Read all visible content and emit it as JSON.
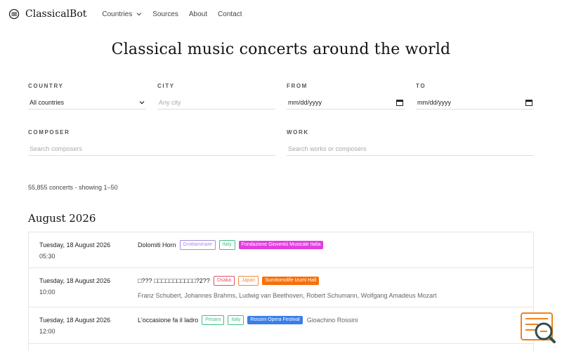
{
  "nav": {
    "brand": "ClassicalBot",
    "links": [
      "Countries",
      "Sources",
      "About",
      "Contact"
    ]
  },
  "hero": {
    "title": "Classical music concerts around the world"
  },
  "filters": {
    "country": {
      "label": "COUNTRY",
      "value": "All countries"
    },
    "city": {
      "label": "CITY",
      "placeholder": "Any city"
    },
    "from": {
      "label": "FROM",
      "value": "mm/dd/yyyy"
    },
    "to": {
      "label": "TO",
      "value": "mm/dd/yyyy"
    },
    "composer": {
      "label": "COMPOSER",
      "placeholder": "Search composers"
    },
    "work": {
      "label": "WORK",
      "placeholder": "Search works or composers"
    }
  },
  "results": {
    "count": "55,855 concerts - showing 1–50"
  },
  "month": "August 2026",
  "rows": [
    {
      "date": "Tuesday, 18 August 2026",
      "time": "05:30",
      "title": "Dolomiti Horn",
      "city": "Grottammare",
      "country": "Italy",
      "venue": "Fondazione Gioventù Musicale Italia",
      "venue_color": "#e13ee0",
      "city_color": "#a58be6",
      "country_color": "#3cbf86",
      "composers": ""
    },
    {
      "date": "Tuesday, 18 August 2026",
      "time": "10:00",
      "title": "□??? □□□□□□□□□□□?2??",
      "city": "Osaka",
      "country": "Japan",
      "venue": "Sumitomolife Izumi Hall",
      "venue_color": "#f7700c",
      "city_color": "#e2526a",
      "country_color": "#f08a3a",
      "composers": "Franz Schubert, Johannes Brahms, Ludwig van Beethoven, Robert Schumann, Wolfgang Amadeus Mozart"
    },
    {
      "date": "Tuesday, 18 August 2026",
      "time": "12:00",
      "title": "L'occasione fa il ladro",
      "city": "Pesaro",
      "country": "Italy",
      "venue": "Rossini Opera Festival",
      "venue_color": "#3a7ee8",
      "city_color": "#3cbf86",
      "country_color": "#3cbf86",
      "composers": "Gioachino Rossini"
    }
  ],
  "colors": {
    "accent": "#f0821e",
    "border": "#e5e5e5"
  }
}
